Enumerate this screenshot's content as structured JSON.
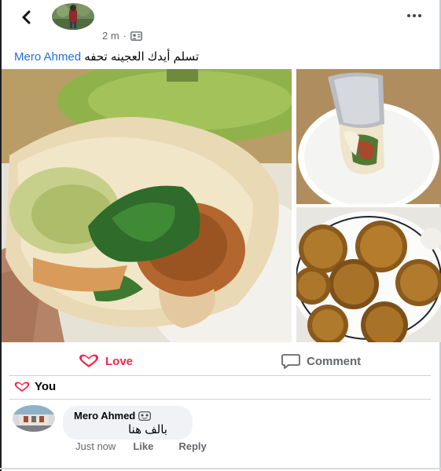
{
  "header": {
    "back_icon": "chevron-left-icon",
    "more_icon": "more-horizontal-icon",
    "timestamp": "2 m",
    "separator": "·",
    "privacy_icon": "friends-audience-icon"
  },
  "caption": {
    "mention": "Mero Ahmed",
    "message": "تسلم أيدك العجينه تحفه"
  },
  "photos": [
    {
      "name": "falafel-wrap-closeup"
    },
    {
      "name": "wrap-on-plate"
    },
    {
      "name": "falafel-balls"
    }
  ],
  "actions": {
    "love_label": "Love",
    "comment_label": "Comment"
  },
  "reactions": {
    "label": "You",
    "icon": "heart-icon"
  },
  "comment": {
    "author": "Mero Ahmed",
    "author_badge_icon": "emoji-badge-icon",
    "text": "بالف هنا",
    "time": "Just now",
    "like_label": "Like",
    "reply_label": "Reply"
  },
  "colors": {
    "love": "#f0284a",
    "link": "#216fdb",
    "secondary_text": "#65676b",
    "bubble": "#f0f2f5"
  }
}
